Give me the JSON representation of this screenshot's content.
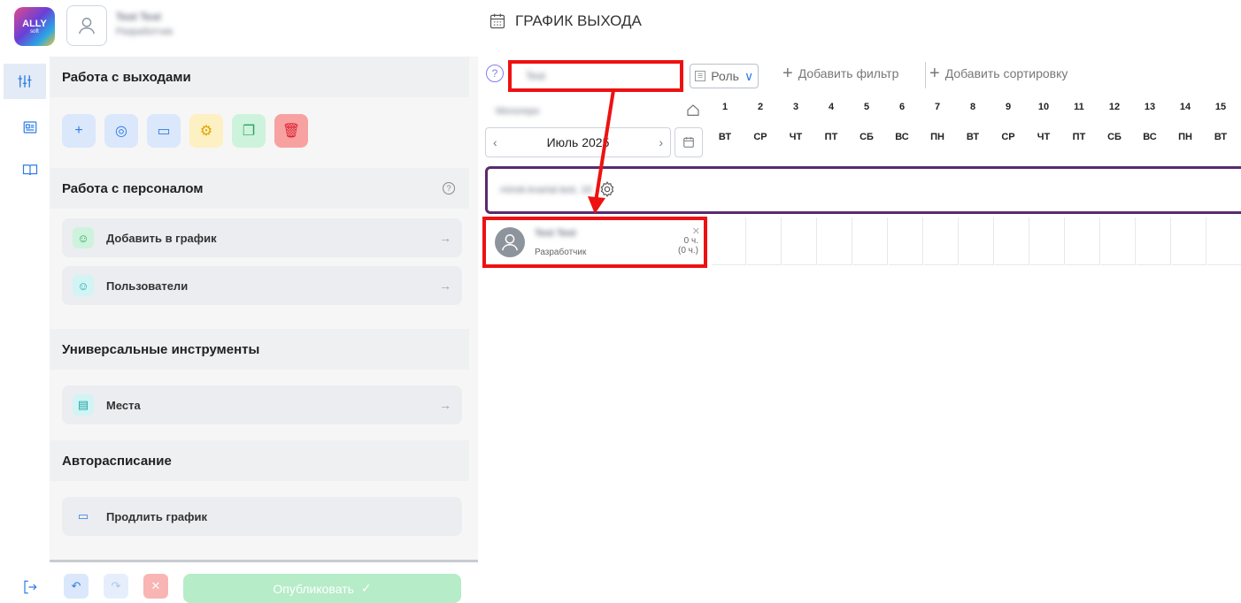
{
  "header": {
    "logo_text": "ALLY",
    "logo_sub": "soft",
    "user_name": "Test Test",
    "user_role": "Разработчик",
    "page_title": "ГРАФИК ВЫХОДА"
  },
  "rail": {
    "icons": [
      "sliders-icon",
      "id-card-icon",
      "book-icon",
      "logout-icon"
    ]
  },
  "left_panel": {
    "sections": {
      "exits": "Работа с выходами",
      "staff": "Работа с персоналом",
      "tools": "Универсальные инструменты",
      "autoschedule": "Авторасписание"
    },
    "tool_buttons": [
      {
        "icon": "plus-icon",
        "glyph": "+",
        "bg": "#dbe7fb",
        "fg": "#2f7de1"
      },
      {
        "icon": "search-user-icon",
        "glyph": "◎",
        "bg": "#dbe7fb",
        "fg": "#2f7de1"
      },
      {
        "icon": "document-icon",
        "glyph": "▭",
        "bg": "#dbe7fb",
        "fg": "#2f7de1"
      },
      {
        "icon": "settings-icon",
        "glyph": "⚙",
        "bg": "#fdf0c2",
        "fg": "#e0a400"
      },
      {
        "icon": "copy-icon",
        "glyph": "❐",
        "bg": "#cdf3dc",
        "fg": "#2e9e5e"
      },
      {
        "icon": "trash-icon",
        "glyph": "🗑",
        "bg": "#f7a1a1",
        "fg": "#d23"
      }
    ],
    "items": {
      "add_to_schedule": "Добавить в график",
      "users": "Пользователи",
      "places": "Места",
      "extend_schedule": "Продлить график"
    }
  },
  "bottom_bar": {
    "publish_label": "Опубликовать"
  },
  "toolbar": {
    "search_value": "Test",
    "role_label": "Роль",
    "add_filter_label": "Добавить фильтр",
    "add_sort_label": "Добавить сортировку"
  },
  "calendar": {
    "group_label": "Monorepo",
    "month_label": "Июль 2025",
    "days": [
      {
        "n": "1",
        "w": "ВТ"
      },
      {
        "n": "2",
        "w": "СР"
      },
      {
        "n": "3",
        "w": "ЧТ"
      },
      {
        "n": "4",
        "w": "ПТ"
      },
      {
        "n": "5",
        "w": "СБ"
      },
      {
        "n": "6",
        "w": "ВС"
      },
      {
        "n": "7",
        "w": "ПН"
      },
      {
        "n": "8",
        "w": "ВТ"
      },
      {
        "n": "9",
        "w": "СР"
      },
      {
        "n": "10",
        "w": "ЧТ"
      },
      {
        "n": "11",
        "w": "ПТ"
      },
      {
        "n": "12",
        "w": "СБ"
      },
      {
        "n": "13",
        "w": "ВС"
      },
      {
        "n": "14",
        "w": "ПН"
      },
      {
        "n": "15",
        "w": "ВТ"
      }
    ],
    "group_bar_label": "minsk.kvartal.test, 18",
    "employee": {
      "name": "Test Test",
      "role": "Разработчик",
      "hours": "0 ч.",
      "hours_total": "(0 ч.)"
    }
  },
  "colors": {
    "accent": "#2f7de1",
    "highlight": "#ee1111",
    "group_border": "#5a2a6e",
    "publish": "#b6ecc8"
  }
}
